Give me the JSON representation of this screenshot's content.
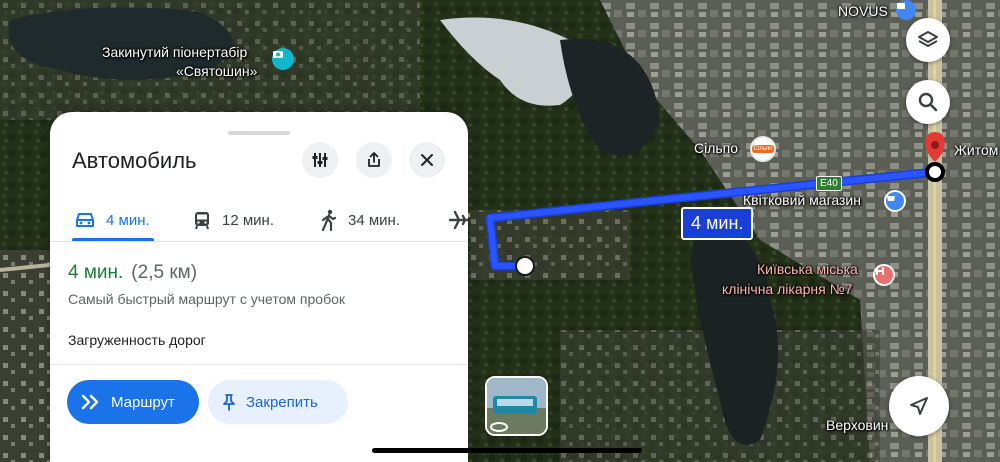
{
  "map": {
    "labels": {
      "camp_line1": "Закинутий піонертабір",
      "camp_line2": "«Святошин»",
      "novus": "NOVUS",
      "silpo": "Сільпо",
      "silpo_badge": "Сільпо",
      "zhytom": "Житом",
      "e40": "E40",
      "flower_shop": "Квітковий магазин",
      "hospital_line1": "Київська міська",
      "hospital_line2": "клінічна лікарня №7",
      "verkhovyn": "Верховин"
    },
    "route_bubble": "4 мин.",
    "route_color": "#2a54ff",
    "destination_color": "#e53935"
  },
  "map_buttons": [
    "layers-icon",
    "search-icon",
    "navigate-icon"
  ],
  "sheet": {
    "title": "Автомобиль",
    "actions": [
      "options-icon",
      "share-icon",
      "close-icon"
    ],
    "modes": [
      {
        "icon": "car-icon",
        "label": "4 мин.",
        "active": true
      },
      {
        "icon": "transit-icon",
        "label": "12 мин."
      },
      {
        "icon": "walk-icon",
        "label": "34 мин."
      },
      {
        "icon": "plane-icon",
        "label": ""
      }
    ],
    "eta_time": "4 мин.",
    "eta_distance": "(2,5 км)",
    "route_description": "Самый быстрый маршрут с учетом пробок",
    "traffic_label": "Загруженность дорог",
    "route_button": "Маршрут",
    "pin_button": "Закрепить"
  },
  "colors": {
    "accent": "#1a73e8",
    "eta_green": "#188038",
    "pin_bg": "#e8f0fe"
  }
}
